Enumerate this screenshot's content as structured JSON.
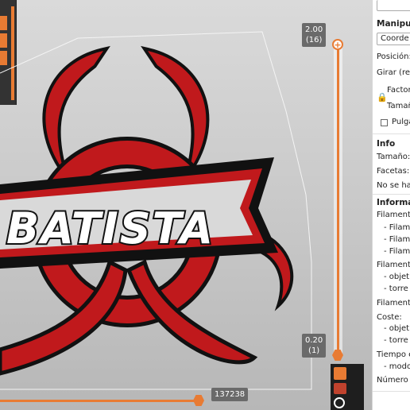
{
  "viewport": {
    "logo_text": "BATISTA",
    "layer_slider": {
      "top_value": "2.00",
      "top_layer": "(16)",
      "bottom_value": "0.20",
      "bottom_layer": "(1)"
    },
    "move_slider_value": "137238"
  },
  "colors": {
    "accent": "#e87b33",
    "logo_red": "#c0191c",
    "logo_dark": "#111111",
    "logo_silver": "#d9d9d9"
  },
  "right_panel": {
    "manipulation": {
      "title": "Manipu",
      "coords_select": "Coorde",
      "position_label": "Posición:",
      "rotate_label": "Girar (rela",
      "scale_factor_label": "Factor",
      "size_label": "Tamañ",
      "lock_icon": "lock-icon",
      "inches_label": "Pulga"
    },
    "info": {
      "title": "Info",
      "size_label": "Tamaño:",
      "facets_label": "Facetas:",
      "no_label": "No se ha"
    },
    "slice_info": {
      "title": "Informac",
      "filament_1": "Filamento",
      "fil_items": [
        "- Filam",
        "- Filam",
        "- Filam"
      ],
      "filament_2": "Filamento",
      "obj_items_1": [
        "- objet",
        "- torre"
      ],
      "filament_3": "Filamento",
      "cost_label": "Coste:",
      "cost_items": [
        "- objet",
        "- torre"
      ],
      "time_label": "Tiempo e",
      "time_items": [
        "- modo"
      ],
      "count_label": "Número d"
    }
  }
}
